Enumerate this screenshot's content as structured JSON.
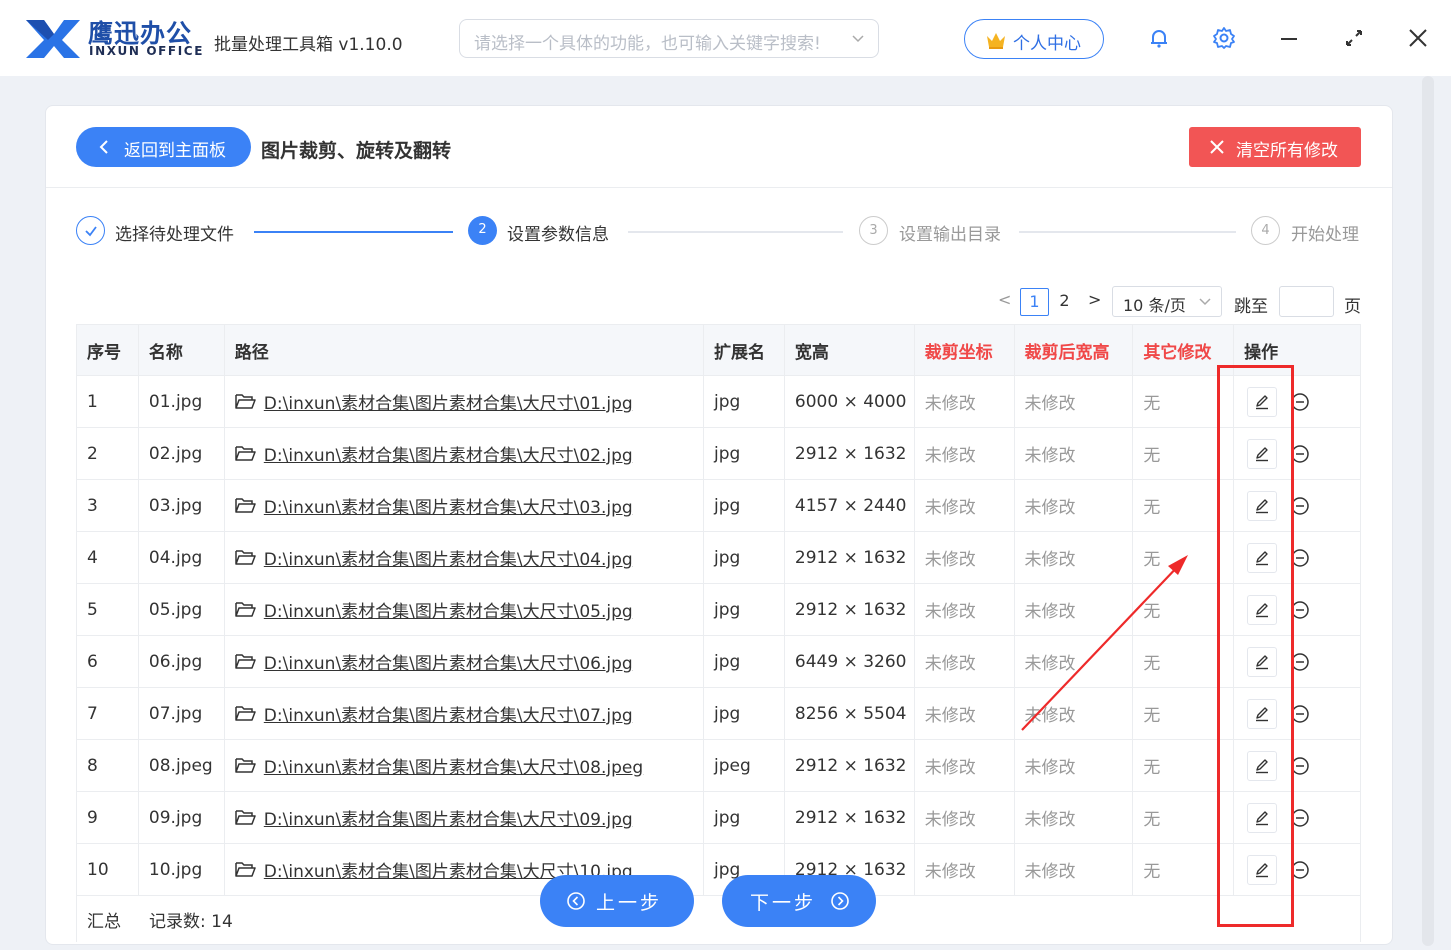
{
  "titlebar": {
    "brand_cn": "鹰迅办公",
    "brand_en": "INXUN OFFICE",
    "app_title": "批量处理工具箱 v1.10.0",
    "search_placeholder": "请选择一个具体的功能，也可输入关键字搜索!",
    "personal_center": "个人中心",
    "icons": [
      "bell-icon",
      "gear-icon",
      "minimize-icon",
      "expand-icon",
      "close-icon"
    ]
  },
  "header": {
    "back_label": "返回到主面板",
    "page_title": "图片裁剪、旋转及翻转",
    "clear_label": "清空所有修改"
  },
  "steps": [
    {
      "num": "✓",
      "label": "选择待处理文件",
      "state": "done"
    },
    {
      "num": "2",
      "label": "设置参数信息",
      "state": "active"
    },
    {
      "num": "3",
      "label": "设置输出目录",
      "state": "pending"
    },
    {
      "num": "4",
      "label": "开始处理",
      "state": "pending"
    }
  ],
  "pagination": {
    "prev": "<",
    "pages": [
      "1",
      "2"
    ],
    "next": ">",
    "page_size": "10 条/页",
    "jump_label": "跳至",
    "page_suffix": "页"
  },
  "table": {
    "headers": [
      "序号",
      "名称",
      "路径",
      "扩展名",
      "宽高",
      "裁剪坐标",
      "裁剪后宽高",
      "其它修改",
      "操作"
    ],
    "rows": [
      {
        "idx": "1",
        "name": "01.jpg",
        "path": "D:\\inxun\\素材合集\\图片素材合集\\大尺寸\\01.jpg",
        "ext": "jpg",
        "wh": "6000 × 4000",
        "crop": "未修改",
        "cropwh": "未修改",
        "other": "无"
      },
      {
        "idx": "2",
        "name": "02.jpg",
        "path": "D:\\inxun\\素材合集\\图片素材合集\\大尺寸\\02.jpg",
        "ext": "jpg",
        "wh": "2912 × 1632",
        "crop": "未修改",
        "cropwh": "未修改",
        "other": "无"
      },
      {
        "idx": "3",
        "name": "03.jpg",
        "path": "D:\\inxun\\素材合集\\图片素材合集\\大尺寸\\03.jpg",
        "ext": "jpg",
        "wh": "4157 × 2440",
        "crop": "未修改",
        "cropwh": "未修改",
        "other": "无"
      },
      {
        "idx": "4",
        "name": "04.jpg",
        "path": "D:\\inxun\\素材合集\\图片素材合集\\大尺寸\\04.jpg",
        "ext": "jpg",
        "wh": "2912 × 1632",
        "crop": "未修改",
        "cropwh": "未修改",
        "other": "无"
      },
      {
        "idx": "5",
        "name": "05.jpg",
        "path": "D:\\inxun\\素材合集\\图片素材合集\\大尺寸\\05.jpg",
        "ext": "jpg",
        "wh": "2912 × 1632",
        "crop": "未修改",
        "cropwh": "未修改",
        "other": "无"
      },
      {
        "idx": "6",
        "name": "06.jpg",
        "path": "D:\\inxun\\素材合集\\图片素材合集\\大尺寸\\06.jpg",
        "ext": "jpg",
        "wh": "6449 × 3260",
        "crop": "未修改",
        "cropwh": "未修改",
        "other": "无"
      },
      {
        "idx": "7",
        "name": "07.jpg",
        "path": "D:\\inxun\\素材合集\\图片素材合集\\大尺寸\\07.jpg",
        "ext": "jpg",
        "wh": "8256 × 5504",
        "crop": "未修改",
        "cropwh": "未修改",
        "other": "无"
      },
      {
        "idx": "8",
        "name": "08.jpeg",
        "path": "D:\\inxun\\素材合集\\图片素材合集\\大尺寸\\08.jpeg",
        "ext": "jpeg",
        "wh": "2912 × 1632",
        "crop": "未修改",
        "cropwh": "未修改",
        "other": "无"
      },
      {
        "idx": "9",
        "name": "09.jpg",
        "path": "D:\\inxun\\素材合集\\图片素材合集\\大尺寸\\09.jpg",
        "ext": "jpg",
        "wh": "2912 × 1632",
        "crop": "未修改",
        "cropwh": "未修改",
        "other": "无"
      },
      {
        "idx": "10",
        "name": "10.jpg",
        "path": "D:\\inxun\\素材合集\\图片素材合集\\大尺寸\\10.jpg",
        "ext": "jpg",
        "wh": "2912 × 1632",
        "crop": "未修改",
        "cropwh": "未修改",
        "other": "无"
      }
    ],
    "footer_label": "汇总",
    "record_label": "记录数: 14"
  },
  "nav": {
    "prev_label": "上一步",
    "next_label": "下一步"
  },
  "colors": {
    "primary": "#3b82f6",
    "danger": "#f25555",
    "highlight": "#ee2a2a"
  }
}
